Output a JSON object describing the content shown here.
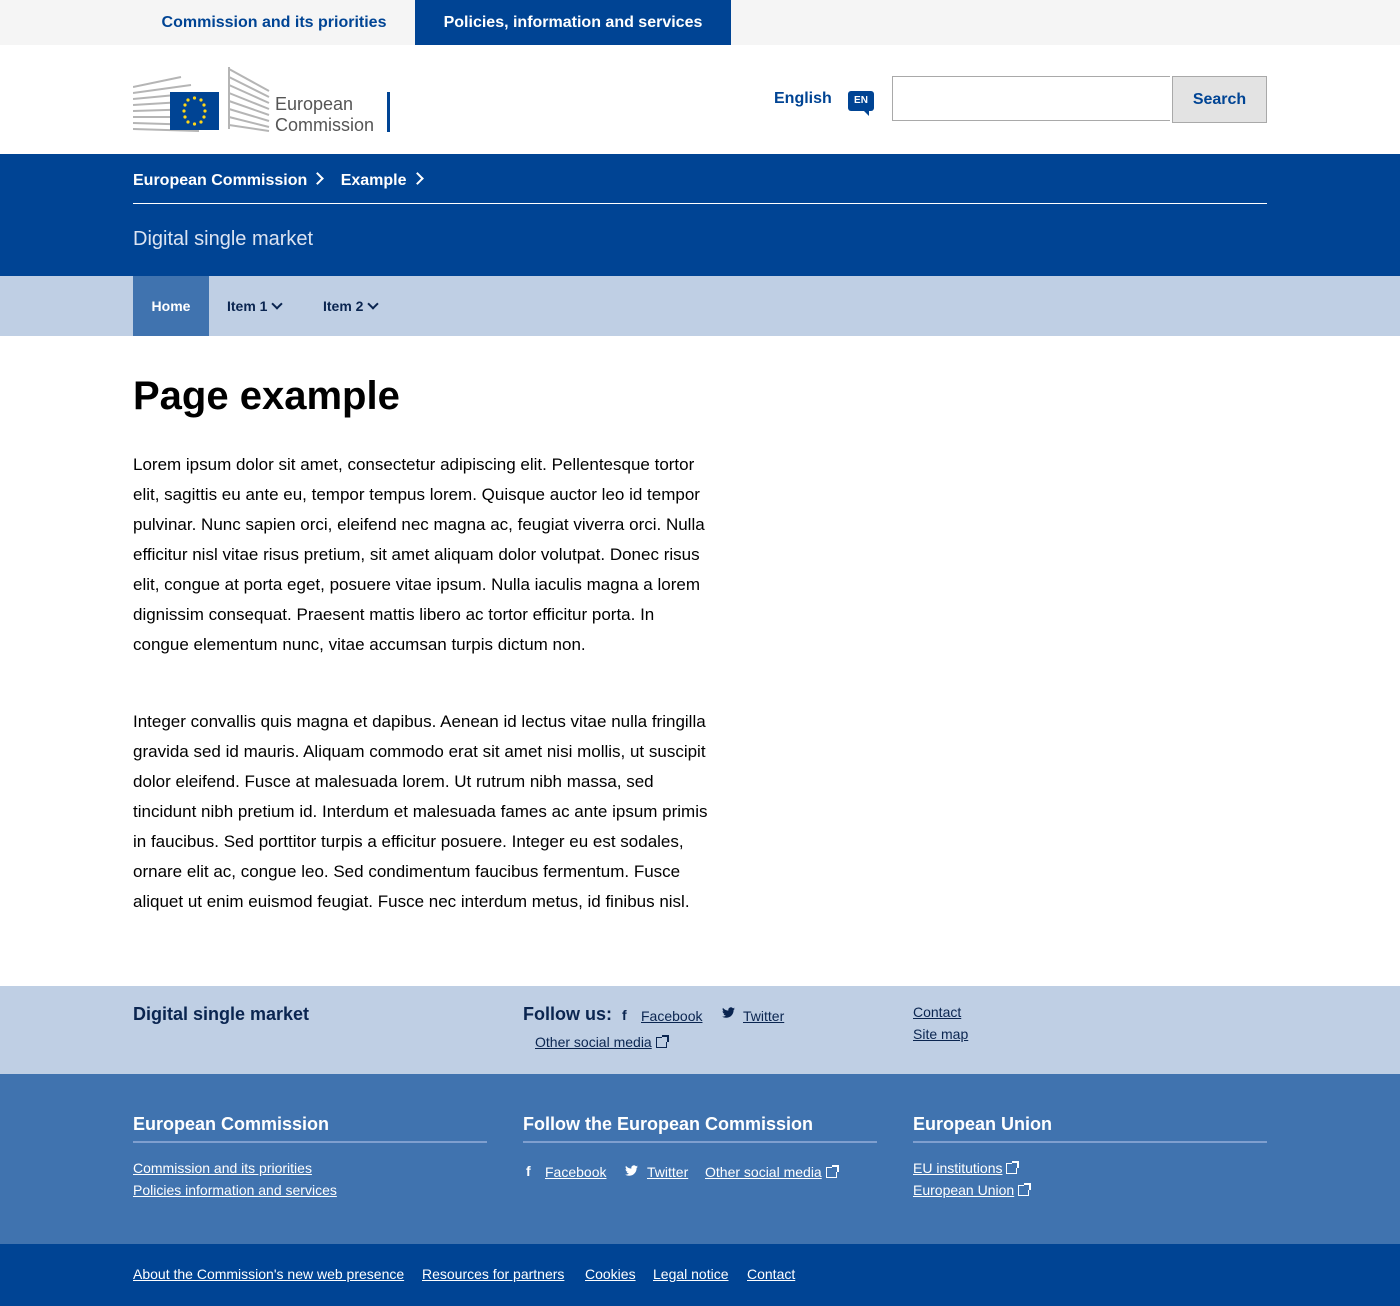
{
  "top_tabs": [
    {
      "label": "Commission and its priorities",
      "active": false
    },
    {
      "label": "Policies, information and services",
      "active": true
    }
  ],
  "header": {
    "logo_text_line1": "European",
    "logo_text_line2": "Commission",
    "language_label": "English",
    "language_code": "EN",
    "search_placeholder": "",
    "search_button": "Search"
  },
  "breadcrumb": [
    "European Commission",
    "Example"
  ],
  "site_title": "Digital single market",
  "site_nav": [
    {
      "label": "Home",
      "active": true,
      "dropdown": false
    },
    {
      "label": "Item 1",
      "active": false,
      "dropdown": true
    },
    {
      "label": "Item 2",
      "active": false,
      "dropdown": true
    }
  ],
  "main": {
    "title": "Page example",
    "paragraphs": [
      "Lorem ipsum dolor sit amet, consectetur adipiscing elit. Pellentesque tortor elit, sagittis eu ante eu, tempor tempus lorem. Quisque auctor leo id tempor pulvinar. Nunc sapien orci, eleifend nec magna ac, feugiat viverra orci. Nulla efficitur nisl vitae risus pretium, sit amet aliquam dolor volutpat. Donec risus elit, congue at porta eget, posuere vitae ipsum. Nulla iaculis magna a lorem dignissim consequat. Praesent mattis libero ac tortor efficitur porta. In congue elementum nunc, vitae accumsan turpis dictum non.",
      "Integer convallis quis magna et dapibus. Aenean id lectus vitae nulla fringilla gravida sed id mauris. Aliquam commodo erat sit amet nisi mollis, ut suscipit dolor eleifend. Fusce at malesuada lorem. Ut rutrum nibh massa, sed tincidunt nibh pretium id. Interdum et malesuada fames ac ante ipsum primis in faucibus. Sed porttitor turpis a efficitur posuere. Integer eu est sodales, ornare elit ac, congue leo. Sed condimentum faucibus fermentum. Fusce aliquet ut enim euismod feugiat. Fusce nec interdum metus, id finibus nisl."
    ]
  },
  "footer_site": {
    "title": "Digital single market",
    "follow_label": "Follow us:",
    "facebook": "Facebook",
    "twitter": "Twitter",
    "other_social": "Other social media",
    "contact": "Contact",
    "site_map": "Site map"
  },
  "footer_corporate": {
    "col1_title": "European Commission",
    "col1_links": [
      "Commission and its priorities",
      "Policies information and services"
    ],
    "col2_title": "Follow the European Commission",
    "col2_facebook": "Facebook",
    "col2_twitter": "Twitter",
    "col2_other": "Other social media",
    "col3_title": "European Union",
    "col3_links": [
      "EU institutions",
      "European Union"
    ]
  },
  "footer_bottom": [
    "About the Commission's new web presence",
    "Resources for partners",
    "Cookies",
    "Legal notice",
    "Contact"
  ],
  "colors": {
    "primary_blue": "#004494",
    "mid_blue": "#4073af",
    "light_blue": "#bfcfe4",
    "flag_yellow": "#ffd617"
  }
}
